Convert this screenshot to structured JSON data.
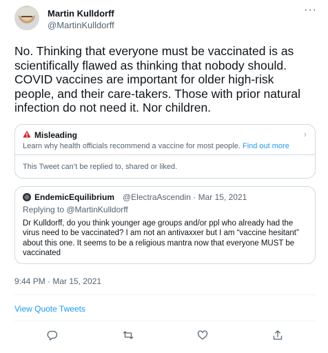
{
  "author": {
    "name": "Martin Kulldorff",
    "handle": "@MartinKulldorff"
  },
  "tweet": {
    "lines": [
      "No. Thinking that everyone must be vaccinated is as",
      "scientifically flawed as thinking that nobody should.",
      "COVID vaccines are important for older high-risk",
      "people, and their care-takers. Those with prior natural",
      "infection do not need it. Nor children."
    ],
    "timestamp": "9:44 PM · Mar 15, 2021"
  },
  "notice": {
    "title": "Misleading",
    "body": "Learn why health officials recommend a vaccine for most people.",
    "link": "Find out more",
    "footer": "This Tweet can’t be replied to, shared or liked."
  },
  "quote": {
    "name": "EndemicEquilibrium",
    "handle": "@ElectraAscendin",
    "date": "Mar 15, 2021",
    "reply_to": "Replying to @MartinKulldorff",
    "lines": [
      "Dr Kulldorff, do you think younger age groups and/or ppl who already had the",
      "virus need to be vaccinated? I am not an antivaxxer but I am “vaccine hesitant”",
      "about this one. It seems to be a religious mantra now that everyone MUST be",
      "vaccinated"
    ]
  },
  "view_quote_tweets": "View Quote Tweets",
  "actions": [
    "reply-icon",
    "retweet-icon",
    "like-icon",
    "share-icon"
  ],
  "colors": {
    "link": "#1d9bf0",
    "secondary_text": "#536471",
    "warning": "#d0222f"
  }
}
